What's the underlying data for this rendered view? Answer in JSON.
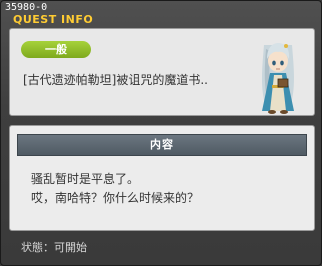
{
  "quest_id": "35980-0",
  "window_title": "QUEST INFO",
  "quest": {
    "tag": "一般",
    "name": "[古代遗迹帕勒坦]被诅咒的魔道书.."
  },
  "content": {
    "header": "内容",
    "lines": [
      "骚乱暂时是平息了。",
      "哎，南哈特？你什么时候来的？"
    ]
  },
  "status_text": "状態：可開始",
  "colors": {
    "title": "#ffcc33",
    "tag_bg": "#8fbd26",
    "header_bg": "#5a656e"
  }
}
